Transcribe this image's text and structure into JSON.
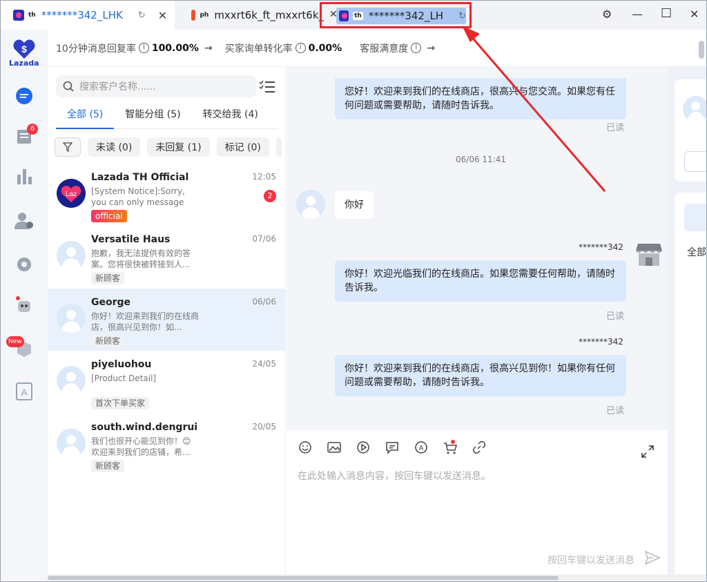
{
  "tabs": [
    {
      "country": "th",
      "name": "*******342_LHK",
      "platform": "lazada"
    },
    {
      "country": "ph",
      "name": "mxxrt6k_ft_mxxrt6k_",
      "platform": "shopee"
    },
    {
      "country": "th",
      "name": "*******342_LH",
      "platform": "lazada"
    }
  ],
  "app": {
    "logo_label": "Lazada"
  },
  "rail": {
    "orders_badge": "6",
    "new_badge": "New"
  },
  "stats": {
    "reply_rate_label": "10分钟消息回复率",
    "reply_rate_value": "100.00%",
    "conversion_label": "买家询单转化率",
    "conversion_value": "0.00%",
    "satisfaction_label": "客服满意度"
  },
  "search": {
    "placeholder": "搜索客户名称......"
  },
  "list_tabs": [
    "全部 (5)",
    "智能分组 (5)",
    "转交给我 (4)"
  ],
  "chips": [
    "未读 (0)",
    "未回复 (1)",
    "标记 (0)"
  ],
  "conversations": [
    {
      "name": "Lazada TH Official",
      "time": "12:05",
      "preview": "[System Notice]:Sorry, you can only message customer...",
      "tag": "official",
      "unread": "2"
    },
    {
      "name": "Versatile Haus",
      "time": "07/06",
      "preview": "抱歉，我无法提供有效的答案。您将很快被转接到人...",
      "tag": "新顾客"
    },
    {
      "name": "George",
      "time": "06/06",
      "preview": "你好！欢迎来到我们的在线商店，很高兴见到你！如...",
      "tag": "新顾客"
    },
    {
      "name": "piyeluohou",
      "time": "24/05",
      "preview": "[Product Detail]",
      "tag": "首次下单买家"
    },
    {
      "name": "south.wind.dengrui",
      "time": "20/05",
      "preview": "我们也很开心能见到你！😊 欢迎来到我们的店铺，希...",
      "tag": "新顾客"
    }
  ],
  "chat": {
    "msg_top": "您好！欢迎来到我们的在线商店，很高兴与您交流。如果您有任何问题或需要帮助，请随时告诉我。",
    "read_label": "已读",
    "date": "06/06 11:41",
    "customer_msg": "你好",
    "sender": "*******342",
    "msg_2": "你好！欢迎光临我们的在线商店。如果您需要任何帮助，请随时告诉我。",
    "msg_3": "你好！欢迎来到我们的在线商店，很高兴见到你！如果你有任何问题或需要帮助，请随时告诉我。"
  },
  "composer": {
    "placeholder": "在此处输入消息内容，按回车键以发送消息。",
    "send_hint": "按回车键以发送消息"
  },
  "right_panel": {
    "tab_label": "全部"
  }
}
